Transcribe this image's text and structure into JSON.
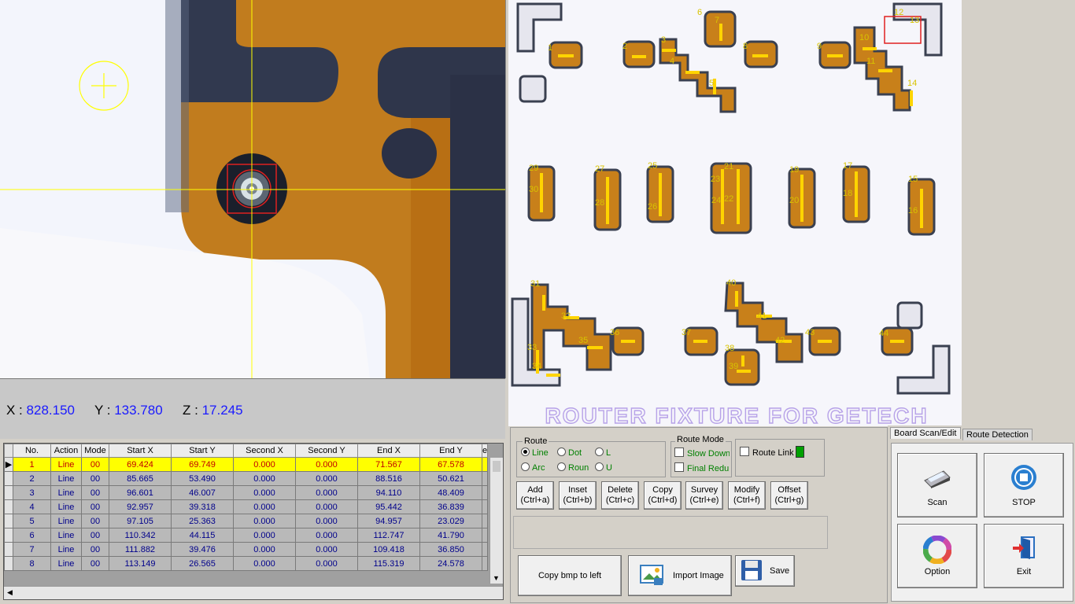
{
  "camera": {
    "x_label": "X :",
    "x_value": "828.150",
    "y_label": "Y :",
    "y_value": "133.780",
    "z_label": "Z :",
    "z_value": "17.245"
  },
  "table": {
    "columns": [
      "No.",
      "Action",
      "Mode",
      "Start X",
      "Start Y",
      "Second X",
      "Second Y",
      "End X",
      "End Y",
      "e"
    ],
    "rows": [
      [
        "1",
        "Line",
        "00",
        "69.424",
        "69.749",
        "0.000",
        "0.000",
        "71.567",
        "67.578"
      ],
      [
        "2",
        "Line",
        "00",
        "85.665",
        "53.490",
        "0.000",
        "0.000",
        "88.516",
        "50.621"
      ],
      [
        "3",
        "Line",
        "00",
        "96.601",
        "46.007",
        "0.000",
        "0.000",
        "94.110",
        "48.409"
      ],
      [
        "4",
        "Line",
        "00",
        "92.957",
        "39.318",
        "0.000",
        "0.000",
        "95.442",
        "36.839"
      ],
      [
        "5",
        "Line",
        "00",
        "97.105",
        "25.363",
        "0.000",
        "0.000",
        "94.957",
        "23.029"
      ],
      [
        "6",
        "Line",
        "00",
        "110.342",
        "44.115",
        "0.000",
        "0.000",
        "112.747",
        "41.790"
      ],
      [
        "7",
        "Line",
        "00",
        "111.882",
        "39.476",
        "0.000",
        "0.000",
        "109.418",
        "36.850"
      ],
      [
        "8",
        "Line",
        "00",
        "113.149",
        "26.565",
        "0.000",
        "0.000",
        "115.319",
        "24.578"
      ]
    ]
  },
  "board": {
    "fixture_text": "ROUTER FIXTURE FOR GETECH",
    "point_labels": [
      "1",
      "2",
      "3",
      "4",
      "5",
      "6",
      "7",
      "8",
      "9",
      "10",
      "11",
      "12",
      "13",
      "14",
      "15",
      "16",
      "17",
      "18",
      "19",
      "20",
      "21",
      "22",
      "23",
      "24",
      "25",
      "26",
      "27",
      "28",
      "29",
      "30",
      "31",
      "32",
      "33",
      "34",
      "35",
      "36",
      "37",
      "38",
      "39",
      "40",
      "41",
      "42",
      "43",
      "44"
    ]
  },
  "route": {
    "title": "Route",
    "options": [
      "Line",
      "Dot",
      "L",
      "Arc",
      "Roun",
      "U"
    ],
    "selected": "Line"
  },
  "route_mode": {
    "title": "Route Mode",
    "slow_down": "Slow Down",
    "final_reduce": "Final Redu"
  },
  "route_link": {
    "label": "Route Link",
    "indicator_color": "#00a000"
  },
  "actions": [
    {
      "label": "Add",
      "shortcut": "(Ctrl+a)"
    },
    {
      "label": "Inset",
      "shortcut": "(Ctrl+b)"
    },
    {
      "label": "Delete",
      "shortcut": "(Ctrl+c)"
    },
    {
      "label": "Copy",
      "shortcut": "(Ctrl+d)"
    },
    {
      "label": "Survey",
      "shortcut": "(Ctrl+e)"
    },
    {
      "label": "Modify",
      "shortcut": "(Ctrl+f)"
    },
    {
      "label": "Offset",
      "shortcut": "(Ctrl+g)"
    }
  ],
  "bottom_buttons": {
    "copy_bmp": "Copy bmp to left",
    "import_image": "Import Image",
    "save": "Save"
  },
  "tabs": [
    "Board Scan/Edit",
    "Route Detection"
  ],
  "side_buttons": {
    "scan": "Scan",
    "stop": "STOP",
    "option": "Option",
    "exit": "Exit"
  }
}
